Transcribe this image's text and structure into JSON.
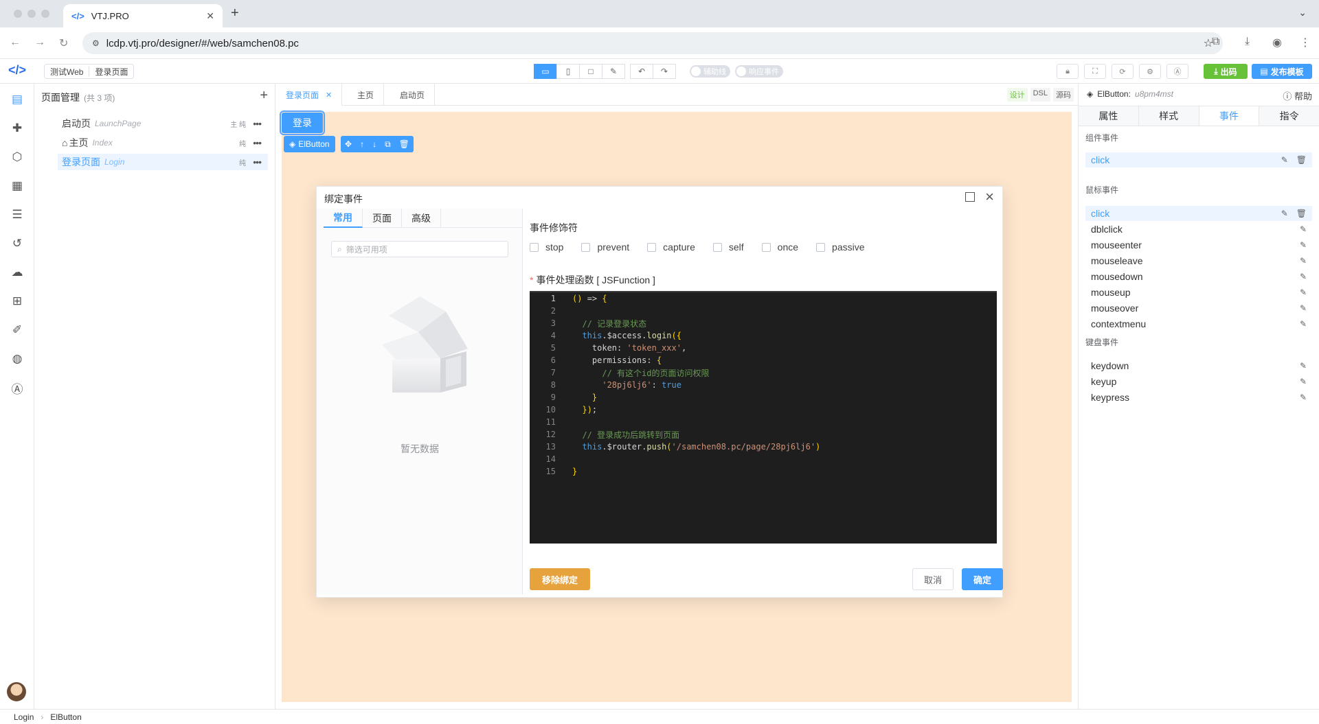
{
  "browser": {
    "tab_title": "VTJ.PRO",
    "tab_favicon": "</>",
    "url": "lcdp.vtj.pro/designer/#/web/samchen08.pc"
  },
  "appbar": {
    "project": "测试Web",
    "page": "登录页面",
    "switch_helper": "辅助线",
    "switch_events": "响应事件",
    "out_label": "出码",
    "publish_label": "发布模板"
  },
  "pages": {
    "title": "页面管理",
    "count": "(共 3 项)",
    "items": [
      {
        "name": "启动页",
        "en": "LaunchPage",
        "tags": "主 纯",
        "icon": ""
      },
      {
        "name": "主页",
        "en": "Index",
        "tags": "纯",
        "icon": "home-icon"
      },
      {
        "name": "登录页面",
        "en": "Login",
        "tags": "纯",
        "icon": ""
      }
    ]
  },
  "doc_tabs": [
    "登录页面",
    "主页",
    "启动页"
  ],
  "modes": [
    "设计",
    "DSL",
    "源码"
  ],
  "canvas": {
    "button_text": "登录",
    "selected_component": "ElButton"
  },
  "modal": {
    "title": "绑定事件",
    "tabs": [
      "常用",
      "页面",
      "高级"
    ],
    "filter_placeholder": "筛选可用项",
    "empty_text": "暂无数据",
    "modifiers_title": "事件修饰符",
    "modifiers": [
      "stop",
      "prevent",
      "capture",
      "self",
      "once",
      "passive"
    ],
    "required_mark": "*",
    "handler_label": "事件处理函数 [ JSFunction ]",
    "code_lines": [
      "() => {",
      "",
      "  // 记录登录状态",
      "  this.$access.login({",
      "    token: 'token_xxx',",
      "    permissions: {",
      "      // 有这个id的页面访问权限",
      "      '28pj6lj6': true",
      "    }",
      "  });",
      "",
      "  // 登录成功后跳转到页面",
      "  this.$router.push('/samchen08.pc/page/28pj6lj6')",
      "",
      "}"
    ],
    "remove_label": "移除绑定",
    "cancel_label": "取消",
    "ok_label": "确定"
  },
  "right_panel": {
    "component": "ElButton:",
    "component_id": "u8pm4mst",
    "help": "帮助",
    "tabs": [
      "属性",
      "样式",
      "事件",
      "指令"
    ],
    "active_tab": "事件",
    "component_events_title": "组件事件",
    "component_events": [
      "click"
    ],
    "mouse_events_title": "鼠标事件",
    "mouse_events": [
      "click",
      "dblclick",
      "mouseenter",
      "mouseleave",
      "mousedown",
      "mouseup",
      "mouseover",
      "contextmenu"
    ],
    "keyboard_events_title": "键盘事件",
    "keyboard_events": [
      "keydown",
      "keyup",
      "keypress"
    ]
  },
  "status": {
    "path": [
      "Login",
      "ElButton"
    ]
  },
  "colors": {
    "primary": "#409eff",
    "warning": "#e6a23c",
    "success": "#67c23a",
    "canvas_bg": "#fde6cc",
    "editor_bg": "#1e1e1e"
  }
}
